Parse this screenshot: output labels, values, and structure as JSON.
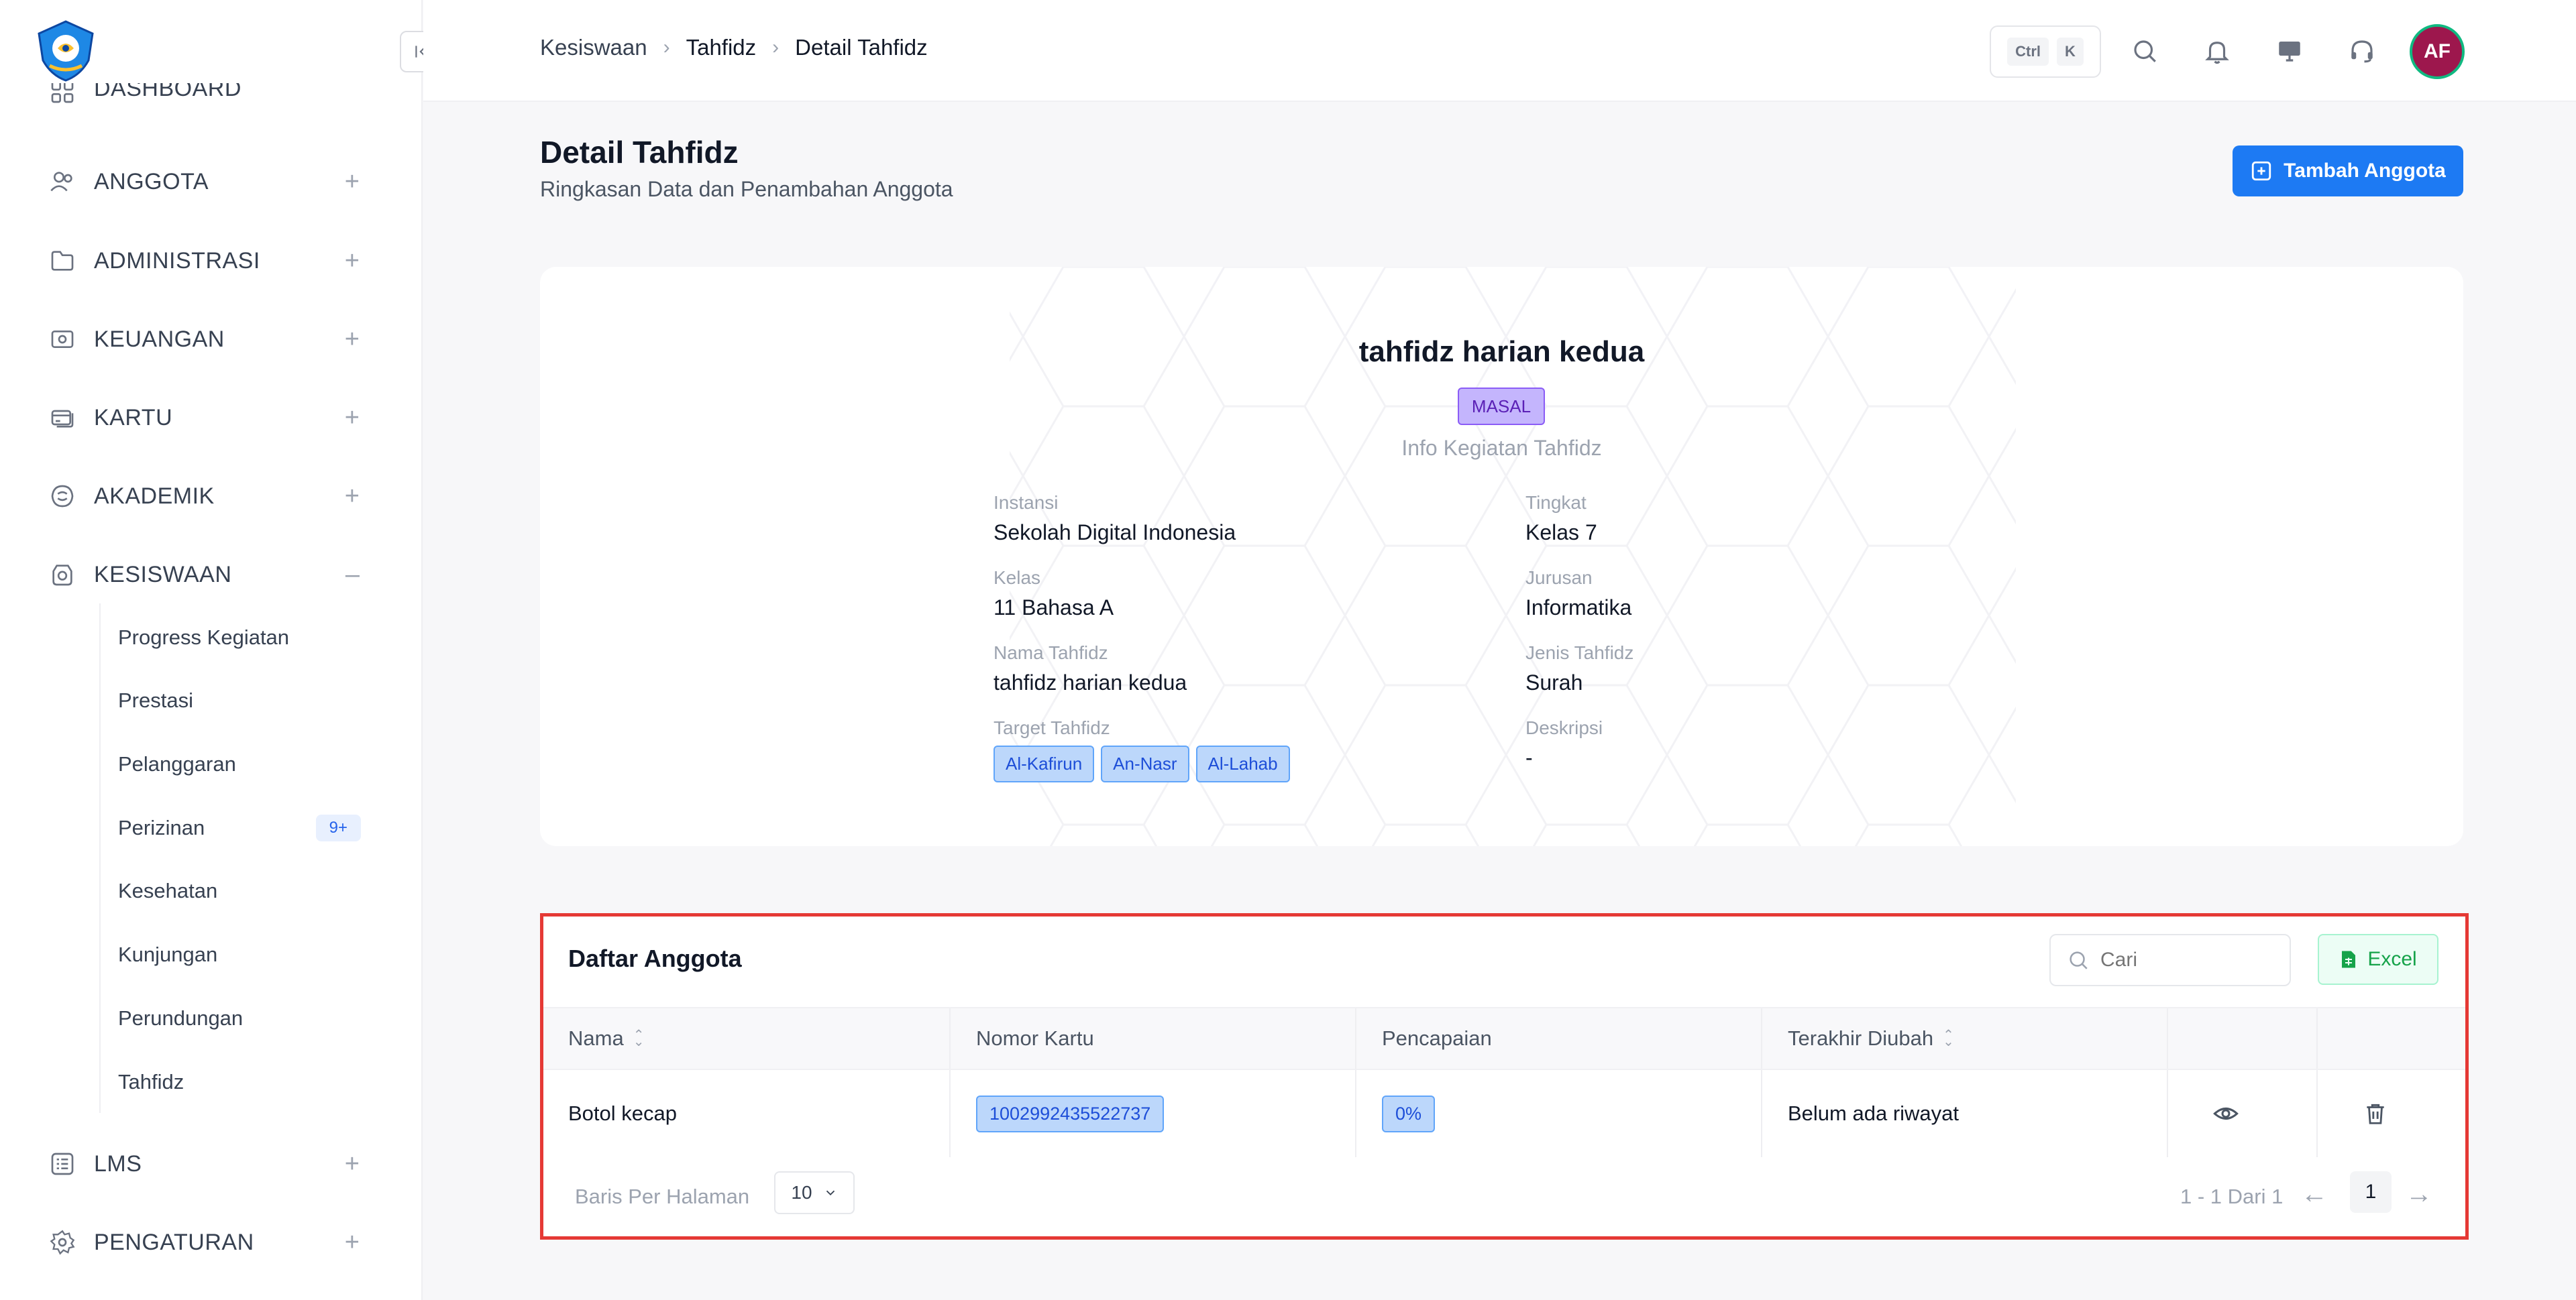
{
  "sidebar": {
    "items": [
      {
        "label": "DASHBOARD",
        "icon": "grid-icon"
      },
      {
        "label": "ANGGOTA",
        "icon": "users-icon",
        "toggle": "+"
      },
      {
        "label": "ADMINISTRASI",
        "icon": "folder-icon",
        "toggle": "+"
      },
      {
        "label": "KEUANGAN",
        "icon": "money-icon",
        "toggle": "+"
      },
      {
        "label": "KARTU",
        "icon": "card-icon",
        "toggle": "+"
      },
      {
        "label": "AKADEMIK",
        "icon": "academic-icon",
        "toggle": "+"
      },
      {
        "label": "KESISWAAN",
        "icon": "student-icon",
        "toggle": "–"
      },
      {
        "label": "LMS",
        "icon": "list-icon",
        "toggle": "+"
      },
      {
        "label": "PENGATURAN",
        "icon": "gear-icon",
        "toggle": "+"
      }
    ],
    "sub_items": [
      {
        "label": "Progress Kegiatan"
      },
      {
        "label": "Prestasi"
      },
      {
        "label": "Pelanggaran"
      },
      {
        "label": "Perizinan",
        "badge": "9+"
      },
      {
        "label": "Kesehatan"
      },
      {
        "label": "Kunjungan"
      },
      {
        "label": "Perundungan"
      },
      {
        "label": "Tahfidz"
      }
    ]
  },
  "header": {
    "breadcrumb": [
      "Kesiswaan",
      "Tahfidz",
      "Detail Tahfidz"
    ],
    "kbd": [
      "Ctrl",
      "K"
    ],
    "avatar": "AF"
  },
  "page": {
    "title": "Detail Tahfidz",
    "subtitle": "Ringkasan Data dan Penambahan Anggota",
    "add_button": "Tambah Anggota"
  },
  "info": {
    "name": "tahfidz harian kedua",
    "badge": "MASAL",
    "section": "Info Kegiatan Tahfidz",
    "fields": {
      "instansi": {
        "label": "Instansi",
        "value": "Sekolah Digital Indonesia"
      },
      "tingkat": {
        "label": "Tingkat",
        "value": "Kelas 7"
      },
      "kelas": {
        "label": "Kelas",
        "value": "11 Bahasa A"
      },
      "jurusan": {
        "label": "Jurusan",
        "value": "Informatika"
      },
      "nama": {
        "label": "Nama Tahfidz",
        "value": "tahfidz harian kedua"
      },
      "jenis": {
        "label": "Jenis Tahfidz",
        "value": "Surah"
      },
      "target": {
        "label": "Target Tahfidz",
        "tags": [
          "Al-Kafirun",
          "An-Nasr",
          "Al-Lahab"
        ]
      },
      "deskripsi": {
        "label": "Deskripsi",
        "value": "-"
      }
    }
  },
  "members": {
    "title": "Daftar Anggota",
    "search_placeholder": "Cari",
    "excel_label": "Excel",
    "columns": [
      "Nama",
      "Nomor Kartu",
      "Pencapaian",
      "Terakhir Diubah"
    ],
    "rows": [
      {
        "nama": "Botol kecap",
        "kartu": "1002992435522737",
        "pencapaian": "0%",
        "terakhir": "Belum ada riwayat"
      }
    ],
    "pager": {
      "per_page_label": "Baris Per Halaman",
      "per_page": "10",
      "range": "1 - 1 Dari 1",
      "page": "1"
    }
  },
  "colors": {
    "primary": "#1d7af3",
    "highlight_border": "#e53935",
    "badge_purple": "#c4b5fd",
    "badge_blue": "#bcd7fb",
    "excel_green": "#16a34a",
    "avatar_bg": "#9d174d"
  }
}
